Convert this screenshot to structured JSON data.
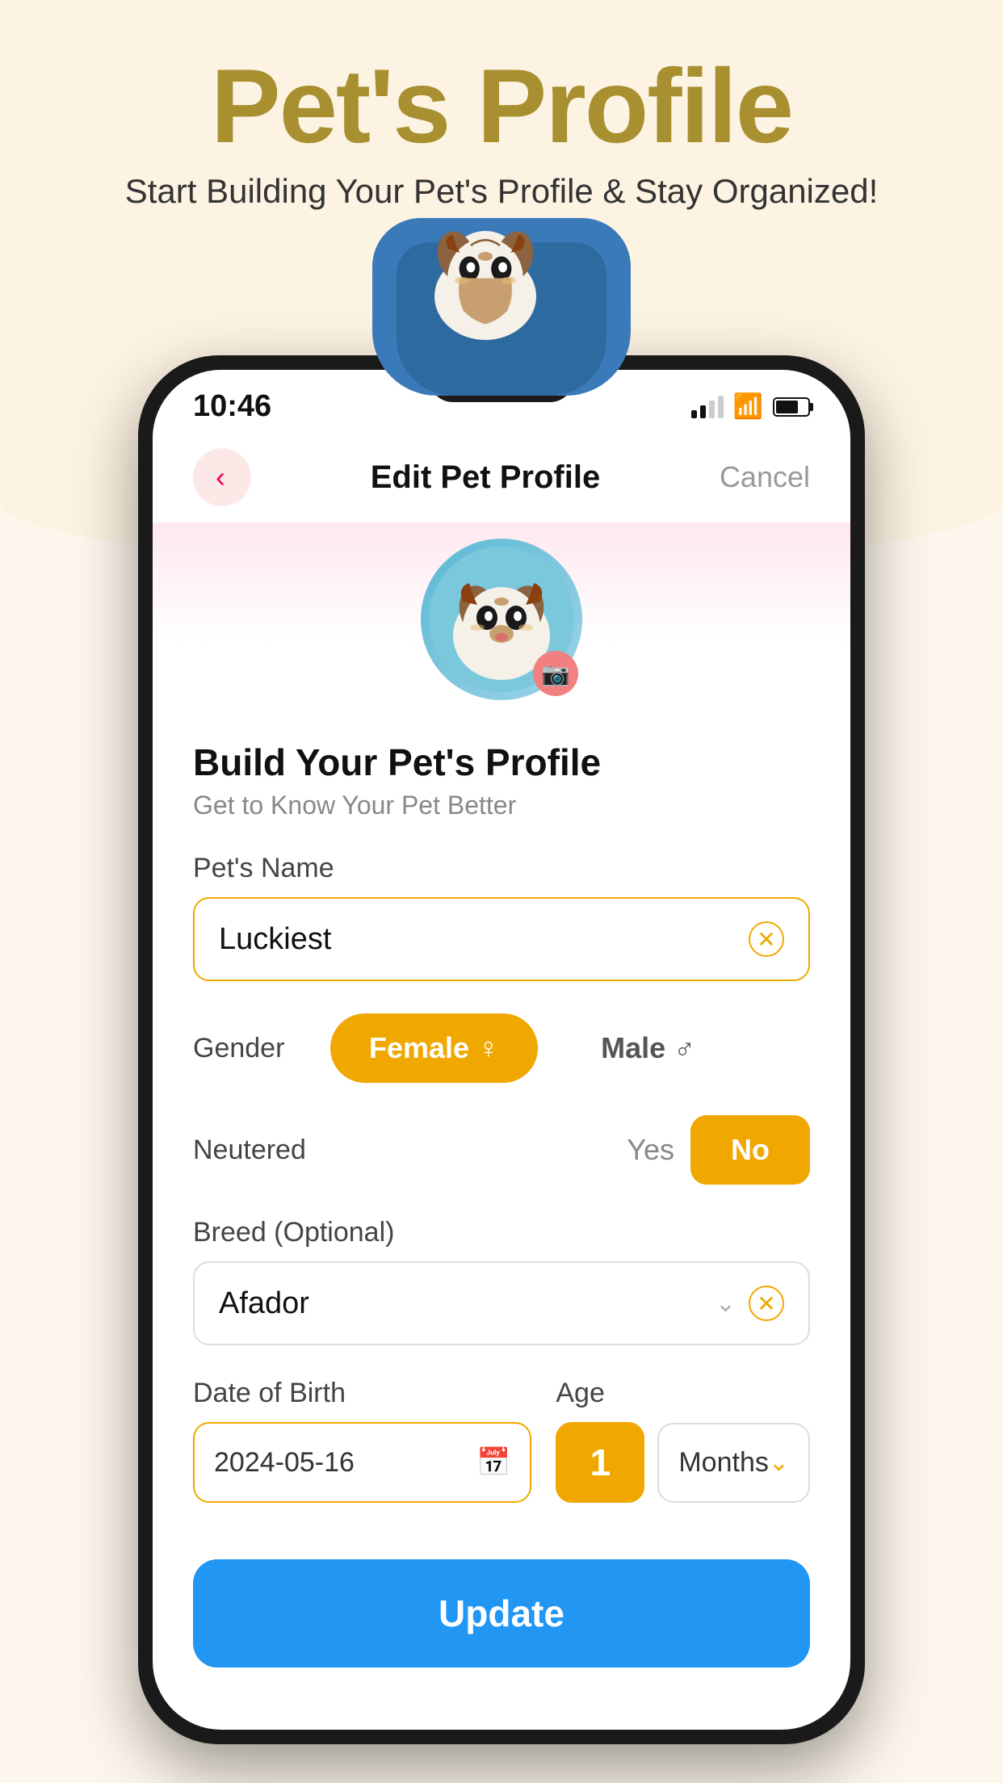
{
  "page": {
    "title": "Pet's Profile",
    "subtitle": "Start Building Your Pet's Profile & Stay Organized!"
  },
  "status_bar": {
    "time": "10:46",
    "battery_text": "67"
  },
  "nav": {
    "title": "Edit Pet Profile",
    "cancel_label": "Cancel"
  },
  "form": {
    "heading": "Build Your Pet's Profile",
    "subheading": "Get to Know Your Pet Better",
    "pet_name_label": "Pet's Name",
    "pet_name_value": "Luckiest",
    "gender_label": "Gender",
    "gender_female": "Female",
    "gender_female_icon": "♂",
    "gender_male": "Male",
    "gender_male_icon": "♂",
    "neutered_label": "Neutered",
    "neutered_yes": "Yes",
    "neutered_no": "No",
    "breed_label": "Breed (Optional)",
    "breed_value": "Afador",
    "dob_label": "Date of Birth",
    "dob_value": "2024-05-16",
    "age_label": "Age",
    "age_number": "1",
    "age_unit": "Months",
    "update_label": "Update"
  }
}
